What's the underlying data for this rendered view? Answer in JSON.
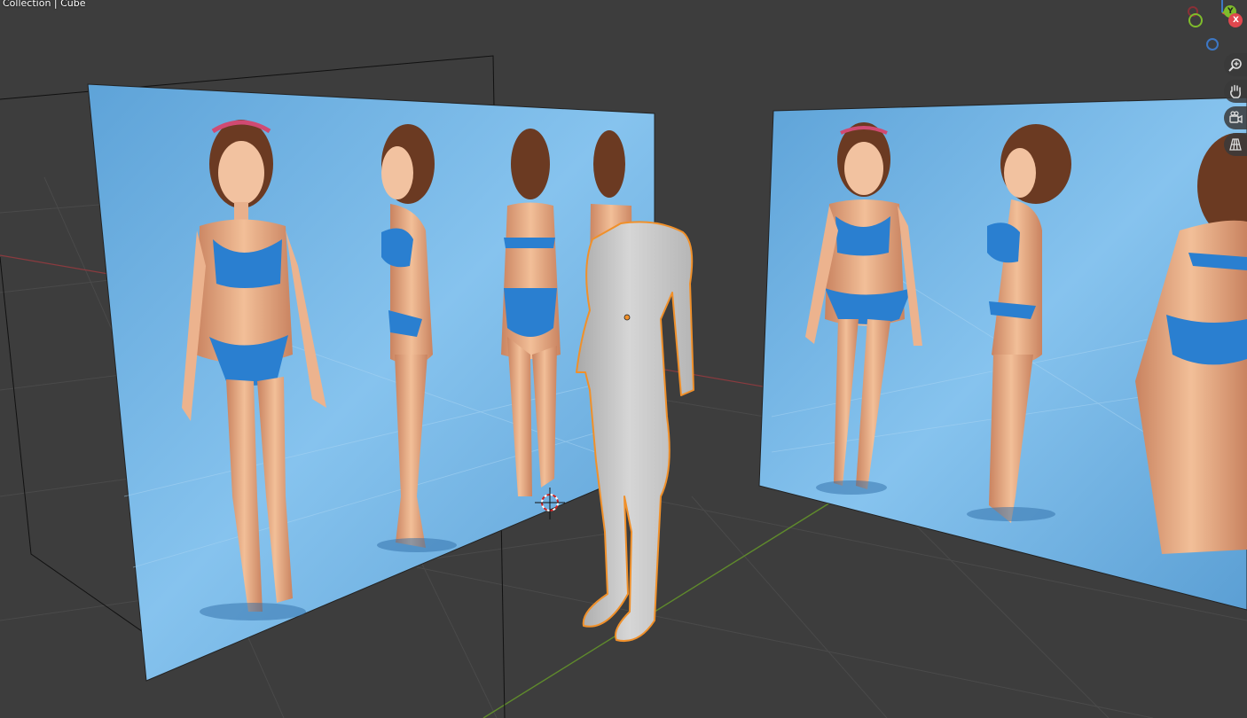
{
  "header": {
    "breadcrumb": "Collection | Cube"
  },
  "gizmo": {
    "x_label": "X",
    "y_label": "Y",
    "x_color": "#e0474e",
    "y_color": "#7fbc2b",
    "z_color": "#3d77c4"
  },
  "nav_tools": [
    {
      "name": "zoom-icon"
    },
    {
      "name": "pan-hand-icon"
    },
    {
      "name": "camera-view-icon"
    },
    {
      "name": "ortho-grid-icon"
    }
  ],
  "scene": {
    "background": "#3d3d3d",
    "selection_outline": "#f0902a",
    "mesh_color": "#c8c8c8",
    "reference_bg": "#6fb2e6"
  }
}
